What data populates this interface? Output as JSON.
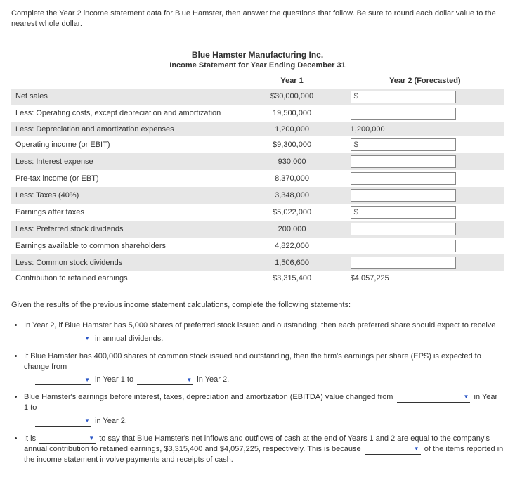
{
  "intro": "Complete the Year 2 income statement data for Blue Hamster, then answer the questions that follow. Be sure to round each dollar value to the nearest whole dollar.",
  "company": "Blue Hamster Manufacturing Inc.",
  "stmt_title": "Income Statement for Year Ending December 31",
  "headers": {
    "blank": "",
    "y1": "Year 1",
    "y2": "Year 2  (Forecasted)"
  },
  "rows": [
    {
      "label": "Net sales",
      "y1": "$30,000,000",
      "y2_type": "input_dollar",
      "shade": true
    },
    {
      "label": "Less: Operating costs, except depreciation and amortization",
      "y1": "19,500,000",
      "y2_type": "input",
      "shade": false
    },
    {
      "label": "Less: Depreciation and amortization expenses",
      "y1": "1,200,000",
      "y2_type": "plain",
      "y2_value": "1,200,000",
      "shade": true
    },
    {
      "label": "Operating income (or EBIT)",
      "y1": "$9,300,000",
      "y2_type": "input_dollar",
      "shade": false
    },
    {
      "label": "Less: Interest expense",
      "y1": "930,000",
      "y2_type": "input",
      "shade": true
    },
    {
      "label": "Pre-tax income (or EBT)",
      "y1": "8,370,000",
      "y2_type": "input",
      "shade": false
    },
    {
      "label": "Less: Taxes (40%)",
      "y1": "3,348,000",
      "y2_type": "input",
      "shade": true
    },
    {
      "label": "Earnings after taxes",
      "y1": "$5,022,000",
      "y2_type": "input_dollar",
      "shade": false
    },
    {
      "label": "Less: Preferred stock dividends",
      "y1": "200,000",
      "y2_type": "input",
      "shade": true
    },
    {
      "label": "Earnings available to common shareholders",
      "y1": "4,822,000",
      "y2_type": "input",
      "shade": false
    },
    {
      "label": "Less: Common stock dividends",
      "y1": "1,506,600",
      "y2_type": "input",
      "shade": true
    },
    {
      "label": "Contribution to retained earnings",
      "y1": "$3,315,400",
      "y2_type": "plain",
      "y2_value": "$4,057,225",
      "shade": false
    }
  ],
  "after_note": "Given the results of the previous income statement calculations, complete the following statements:",
  "q1": {
    "a": "In Year 2, if Blue Hamster has 5,000 shares of preferred stock issued and outstanding, then each preferred share should expect to receive",
    "b": "in annual dividends."
  },
  "q2": {
    "a": "If Blue Hamster has 400,000 shares of common stock issued and outstanding, then the firm's earnings per share (EPS) is expected to change from",
    "b": "in Year 1 to",
    "c": "in Year 2."
  },
  "q3": {
    "a": "Blue Hamster's earnings before interest, taxes, depreciation and amortization (EBITDA) value changed from",
    "b": "in Year 1 to",
    "c": "in Year 2."
  },
  "q4": {
    "a": "It is",
    "b": "to say that Blue Hamster's net inflows and outflows of cash at the end of Years 1 and 2 are equal to the company's annual contribution to retained earnings, $3,315,400 and $4,057,225, respectively. This is because",
    "c": "of the items reported in the income statement involve payments and receipts of cash."
  }
}
